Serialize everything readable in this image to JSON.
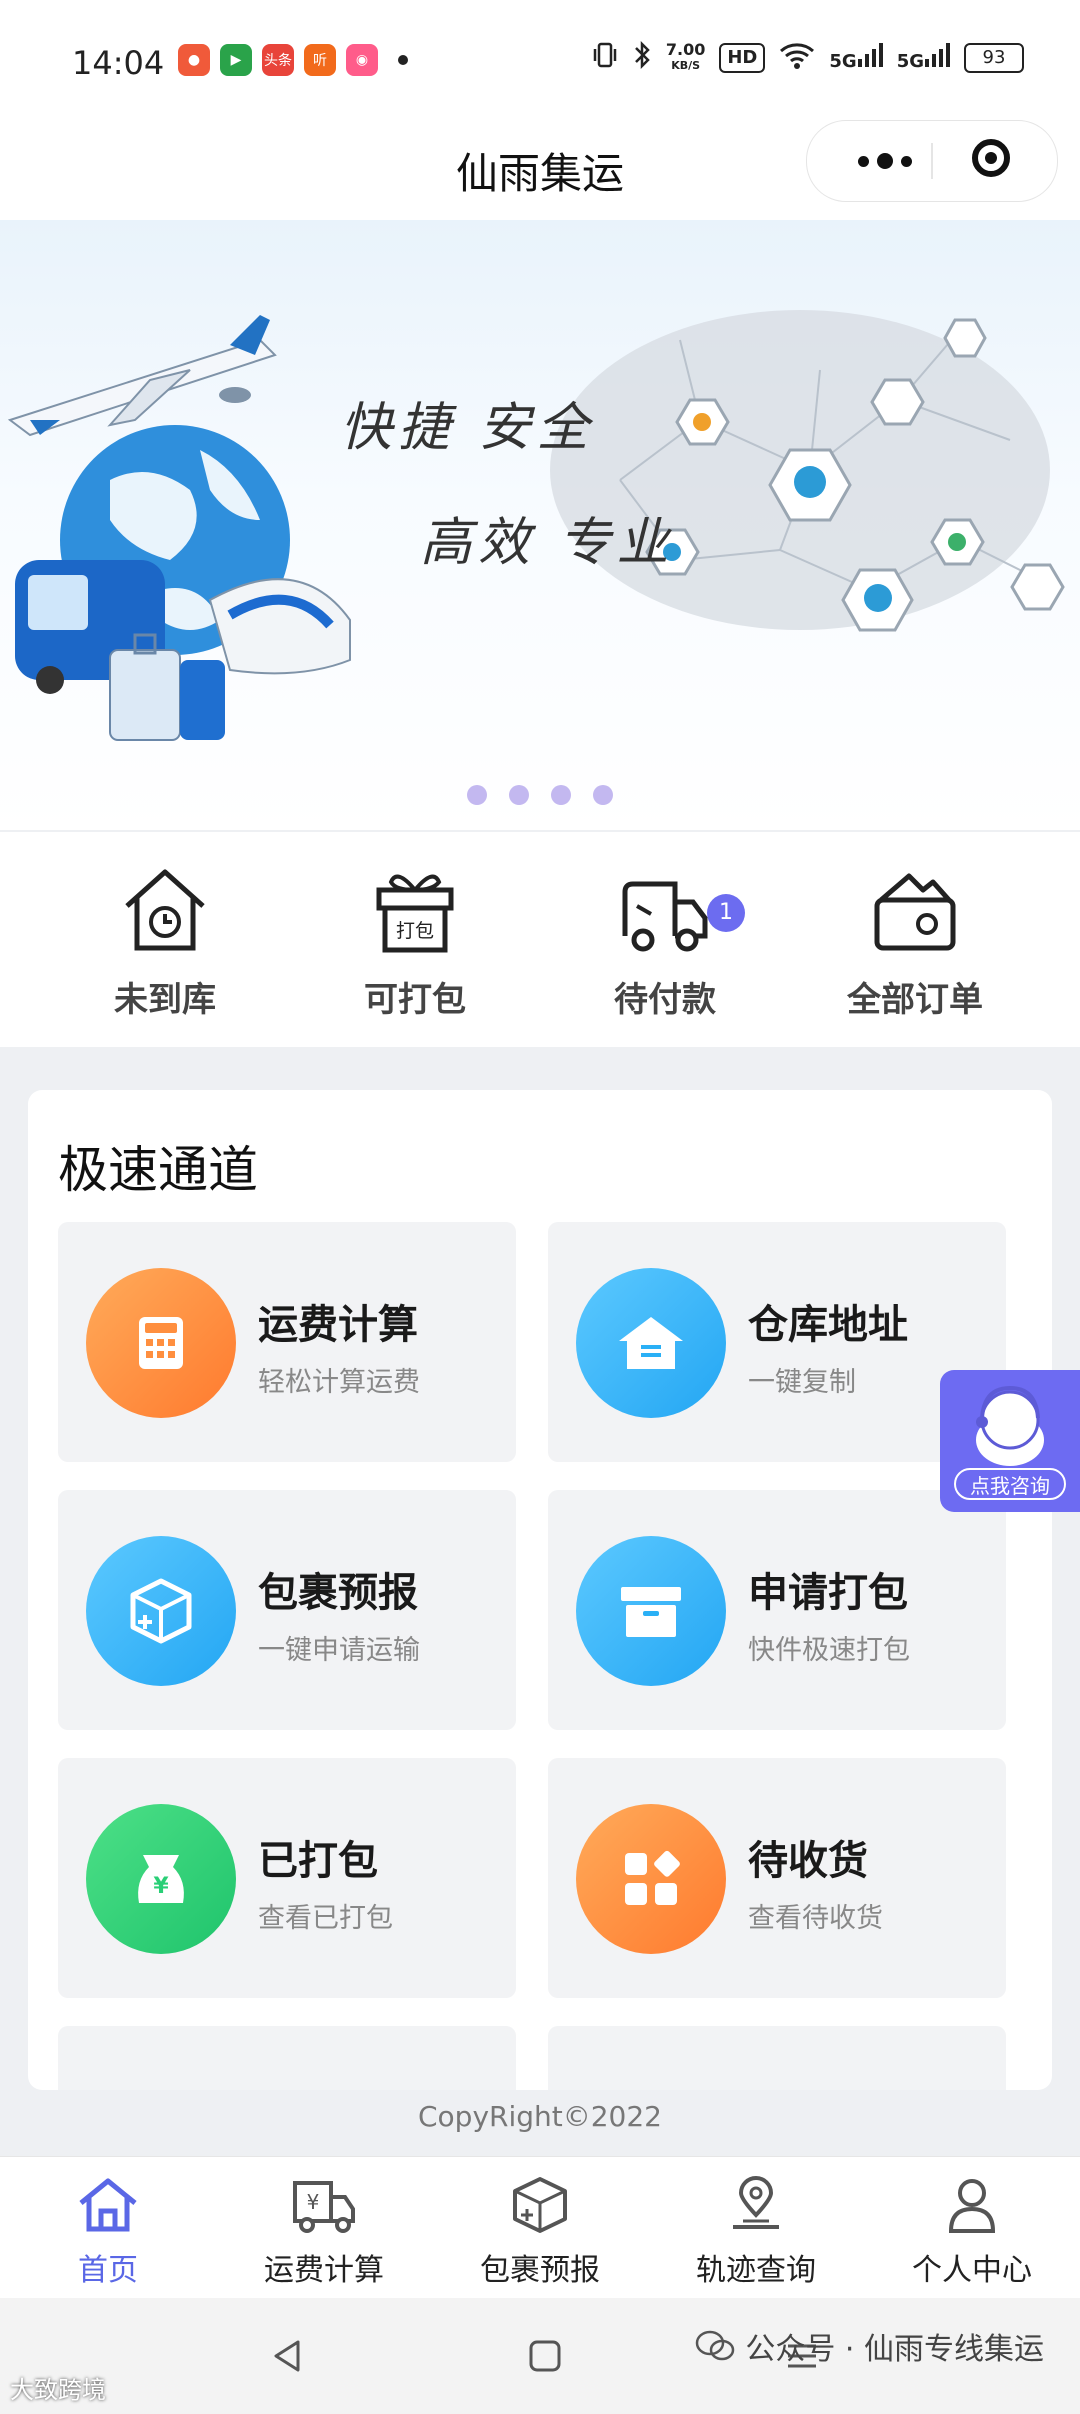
{
  "status_bar": {
    "time": "14:04",
    "net_speed_value": "7.00",
    "net_speed_unit": "KB/S",
    "hd_label": "HD",
    "signal1": "5G",
    "signal2": "5G",
    "battery": "93",
    "apps": [
      {
        "icon": "game-app-icon",
        "color": "#f05a3a"
      },
      {
        "icon": "video-app-icon",
        "color": "#2aa34a"
      },
      {
        "icon": "news-app-icon",
        "color": "#e8443a",
        "text": "头条"
      },
      {
        "icon": "listen-app-icon",
        "color": "#f26a1b",
        "text": "听"
      },
      {
        "icon": "photo-app-icon",
        "color": "#ff5c8a"
      }
    ]
  },
  "header": {
    "title": "仙雨集运"
  },
  "banner": {
    "line1": "快捷  安全",
    "line2": "高效  专业",
    "slide_count": 4
  },
  "quick_actions": [
    {
      "label": "未到库",
      "icon": "house-clock-icon"
    },
    {
      "label": "可打包",
      "icon": "gift-box-icon",
      "icon_text": "打包"
    },
    {
      "label": "待付款",
      "icon": "delivery-truck-icon",
      "badge": "1"
    },
    {
      "label": "全部订单",
      "icon": "wallet-icon"
    }
  ],
  "express": {
    "title": "极速通道",
    "tiles": [
      {
        "title": "运费计算",
        "sub": "轻松计算运费",
        "icon": "calculator-icon",
        "color": "orange"
      },
      {
        "title": "仓库地址",
        "sub": "一键复制",
        "icon": "warehouse-icon",
        "color": "blue"
      },
      {
        "title": "包裹预报",
        "sub": "一键申请运输",
        "icon": "package-plus-icon",
        "color": "blue"
      },
      {
        "title": "申请打包",
        "sub": "快件极速打包",
        "icon": "archive-box-icon",
        "color": "blue"
      },
      {
        "title": "已打包",
        "sub": "查看已打包",
        "icon": "money-bag-icon",
        "color": "green"
      },
      {
        "title": "待收货",
        "sub": "查看待收货",
        "icon": "grid-apps-icon",
        "color": "orange"
      }
    ]
  },
  "consult": {
    "label": "点我咨询"
  },
  "copyright": "CopyRight©2022",
  "tabbar": [
    {
      "label": "首页",
      "icon": "home-icon",
      "active": true
    },
    {
      "label": "运费计算",
      "icon": "freight-truck-icon"
    },
    {
      "label": "包裹预报",
      "icon": "package-icon"
    },
    {
      "label": "轨迹查询",
      "icon": "location-pin-icon"
    },
    {
      "label": "个人中心",
      "icon": "user-icon"
    }
  ],
  "watermark": {
    "left": "大致跨境",
    "right": "公众号 · 仙雨专线集运"
  }
}
